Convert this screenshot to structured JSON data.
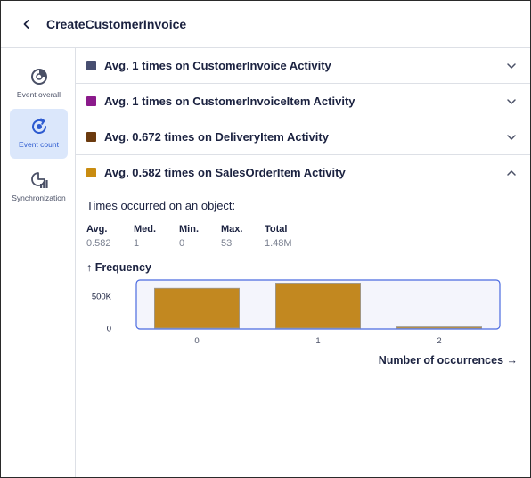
{
  "header": {
    "back_icon": "chevron-left-icon",
    "title": "CreateCustomerInvoice"
  },
  "sidebar": {
    "items": [
      {
        "label": "Event overall",
        "icon": "donut-chart-icon",
        "active": false
      },
      {
        "label": "Event count",
        "icon": "refresh-target-icon",
        "active": true
      },
      {
        "label": "Synchronization",
        "icon": "pie-bars-icon",
        "active": false
      }
    ]
  },
  "accordion": [
    {
      "label": "Avg. 1 times on CustomerInvoice Activity",
      "color": "#474e70",
      "expanded": false
    },
    {
      "label": "Avg. 1 times on CustomerInvoiceItem Activity",
      "color": "#8b1a8b",
      "expanded": false
    },
    {
      "label": "Avg. 0.672 times on DeliveryItem Activity",
      "color": "#6b3a0e",
      "expanded": false
    },
    {
      "label": "Avg. 0.582 times on SalesOrderItem Activity",
      "color": "#c98c10",
      "expanded": true
    }
  ],
  "detail": {
    "subtitle": "Times occurred on an object:",
    "stats": [
      {
        "key": "Avg.",
        "value": "0.582"
      },
      {
        "key": "Med.",
        "value": "1"
      },
      {
        "key": "Min.",
        "value": "0"
      },
      {
        "key": "Max.",
        "value": "53"
      },
      {
        "key": "Total",
        "value": "1.48M"
      }
    ],
    "frequency_label": "↑ Frequency"
  },
  "chart_data": {
    "type": "bar",
    "categories": [
      "0",
      "1",
      "2"
    ],
    "values": [
      620000,
      700000,
      20000
    ],
    "ylabel": "↑ Frequency",
    "xlabel": "Number of occurrences →",
    "yticks": [
      {
        "value": 0,
        "label": "0"
      },
      {
        "value": 500000,
        "label": "500K"
      }
    ],
    "ylim": [
      0,
      720000
    ],
    "bar_color": "#c28820",
    "bar_stroke": "#9a9a9a",
    "brush_color": "#4a6ae0",
    "brush_fill": "#f4f5fc"
  }
}
